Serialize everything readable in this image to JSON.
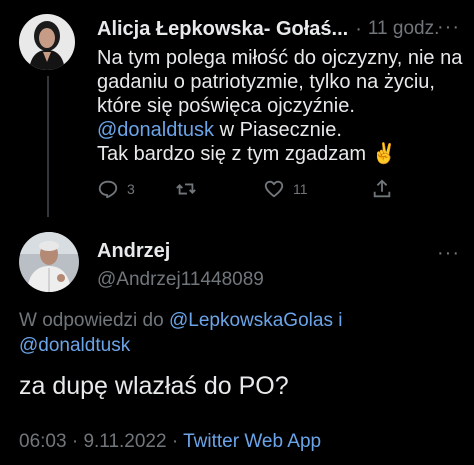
{
  "tweet1": {
    "author_name": "Alicja Łepkowska- Gołaś...",
    "separator": "·",
    "time": "11 godz.",
    "more": "···",
    "lines": [
      "Na tym polega miłość do ojczyzny, nie na",
      "gadaniu o patriotyzmie, tylko na życiu,",
      "które się poświęca ojczyźnie."
    ],
    "mention": "@donaldtusk",
    "mention_suffix": " w Piasecznie.",
    "last_line": "Tak bardzo się z tym zgadzam",
    "emoji": "✌️",
    "reply_count": "3",
    "like_count": "11"
  },
  "tweet2": {
    "author_name": "Andrzej",
    "handle": "@Andrzej11448089",
    "more": "···",
    "reply_prefix": "W odpowiedzi do ",
    "reply_mention1": "@LepkowskaGolas i",
    "reply_mention2": "@donaldtusk",
    "text": "za dupę wlazłaś do PO?",
    "time": "06:03",
    "date": "9.11.2022",
    "separator": "·",
    "app": "Twitter Web App"
  },
  "colors": {
    "background": "#000000",
    "text": "#e7e9ea",
    "muted": "#71767b",
    "link": "#6ba4e8"
  }
}
